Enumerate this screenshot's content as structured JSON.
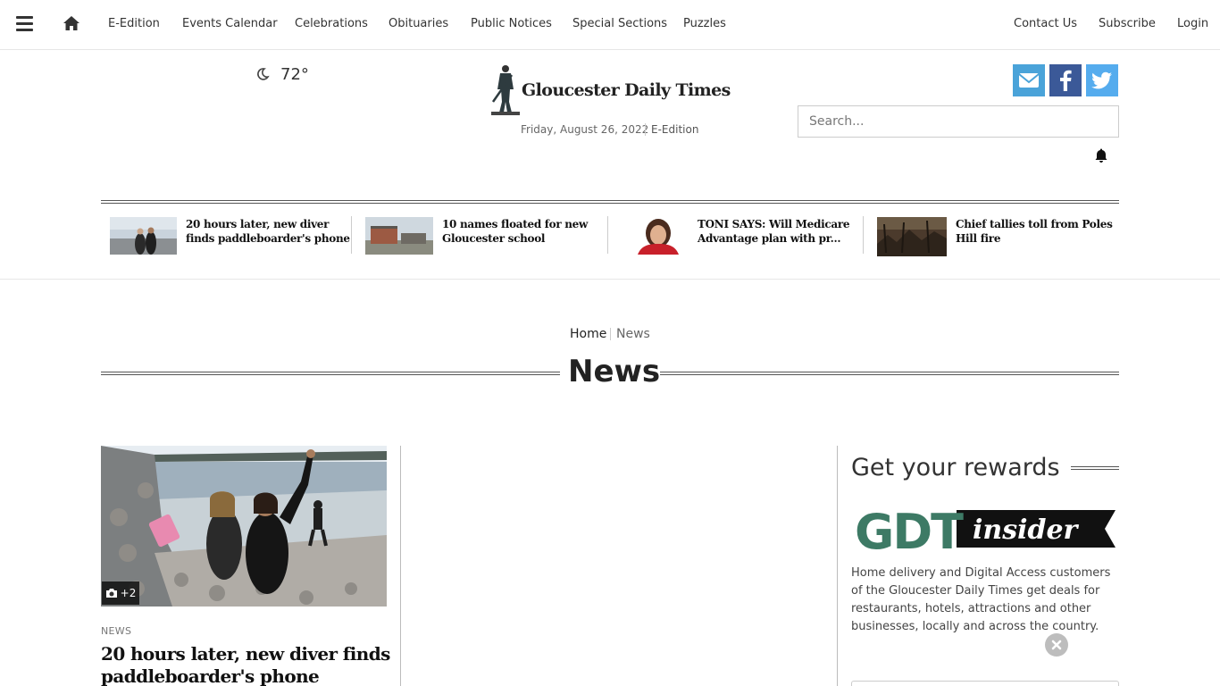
{
  "nav": {
    "links": [
      "E-Edition",
      "Events Calendar",
      "Celebrations",
      "Obituaries",
      "Public Notices",
      "Special Sections",
      "Puzzles"
    ],
    "right_links": [
      "Contact Us",
      "Subscribe",
      "Login"
    ]
  },
  "masthead": {
    "weather_temp": "72°",
    "logo_text": "Gloucester Daily Times",
    "date": "Friday, August 26, 2022",
    "edition_link": "E-Edition",
    "search_placeholder": "Search..."
  },
  "social": {
    "email_color": "#4aa3d9",
    "facebook_color": "#3b5998",
    "twitter_color": "#55acee"
  },
  "headlines": [
    {
      "title": "20 hours later, new diver finds paddleboarder's phone"
    },
    {
      "title": "10 names floated for new Gloucester school"
    },
    {
      "title": "TONI SAYS: Will Medicare Advantage plan with pr..."
    },
    {
      "title": "Chief tallies toll from Poles Hill fire"
    }
  ],
  "breadcrumb": {
    "home": "Home",
    "current": "News"
  },
  "section_title": "News",
  "lead_story": {
    "photo_count": "+2",
    "kicker": "NEWS",
    "title": "20 hours later, new diver finds paddleboarder's phone"
  },
  "rewards": {
    "heading": "Get your rewards",
    "logo_text_left": "GDT",
    "logo_text_right": "insider",
    "description": "Home delivery and Digital Access customers of the Gloucester Daily Times get deals for restaurants, hotels, attractions and other businesses, locally and across the country."
  }
}
